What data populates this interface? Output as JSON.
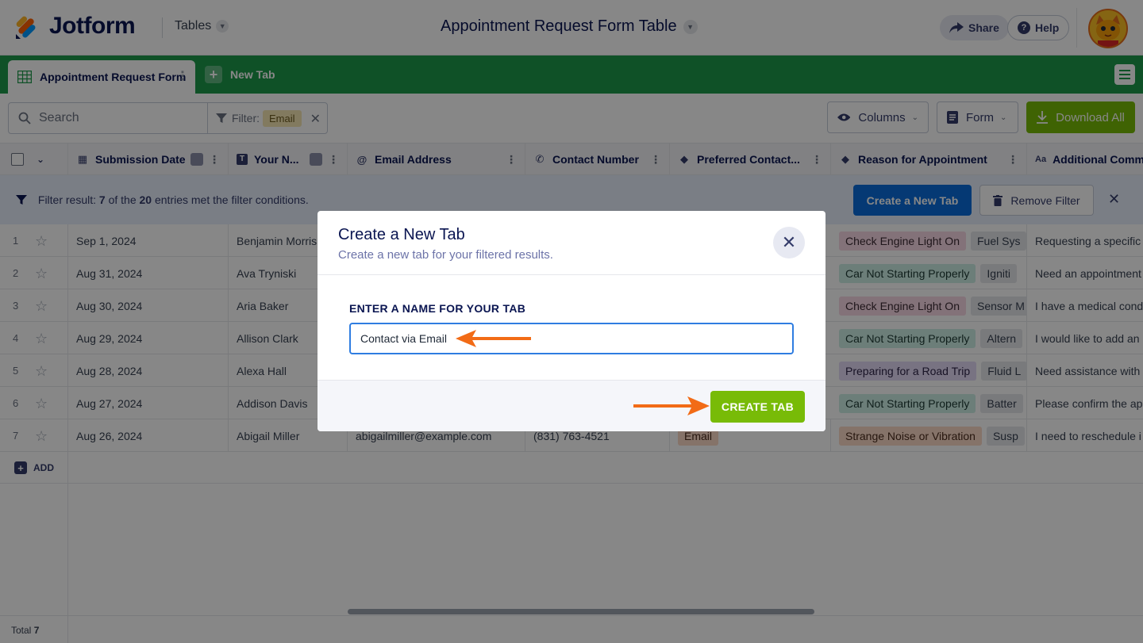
{
  "header": {
    "brand": "Jotform",
    "product": "Tables",
    "page_title": "Appointment Request Form Table",
    "share_label": "Share",
    "help_label": "Help"
  },
  "tabs": {
    "active_label": "Appointment Request Form",
    "new_tab_label": "New Tab"
  },
  "toolbar": {
    "search_placeholder": "Search",
    "filter_label": "Filter:",
    "filter_value": "Email",
    "columns_label": "Columns",
    "form_label": "Form",
    "download_label": "Download All"
  },
  "columns": [
    {
      "label": "Submission Date",
      "icon": "calendar-icon"
    },
    {
      "label": "Your N...",
      "icon": "text-icon"
    },
    {
      "label": "Email Address",
      "icon": "at-icon"
    },
    {
      "label": "Contact Number",
      "icon": "phone-icon"
    },
    {
      "label": "Preferred Contact...",
      "icon": "tag-icon"
    },
    {
      "label": "Reason for Appointment",
      "icon": "tag-icon"
    },
    {
      "label": "Additional Comm",
      "icon": "text-aa-icon"
    }
  ],
  "filter_bar": {
    "prefix": "Filter result: ",
    "count": "7",
    "middle": " of the ",
    "total": "20",
    "suffix": " entries met the filter conditions.",
    "create_tab_label": "Create a New Tab",
    "remove_filter_label": "Remove Filter"
  },
  "rows": [
    {
      "num": "1",
      "date": "Sep 1, 2024",
      "name": "Benjamin Morris",
      "reason": "Check Engine Light On",
      "reason_color": "pink",
      "extra": "Fuel Sys",
      "comment": "Requesting a specific"
    },
    {
      "num": "2",
      "date": "Aug 31, 2024",
      "name": "Ava Tryniski",
      "reason": "Car Not Starting Properly",
      "reason_color": "teal",
      "extra": "Igniti",
      "comment": "Need an appointment"
    },
    {
      "num": "3",
      "date": "Aug 30, 2024",
      "name": "Aria Baker",
      "reason": "Check Engine Light On",
      "reason_color": "pink",
      "extra": "Sensor M",
      "comment": "I have a medical cond"
    },
    {
      "num": "4",
      "date": "Aug 29, 2024",
      "name": "Allison Clark",
      "reason": "Car Not Starting Properly",
      "reason_color": "teal",
      "extra": "Altern",
      "comment": "I would like to add an"
    },
    {
      "num": "5",
      "date": "Aug 28, 2024",
      "name": "Alexa Hall",
      "reason": "Preparing for a Road Trip",
      "reason_color": "purple",
      "extra": "Fluid L",
      "comment": "Need assistance with"
    },
    {
      "num": "6",
      "date": "Aug 27, 2024",
      "name": "Addison Davis",
      "reason": "Car Not Starting Properly",
      "reason_color": "teal",
      "extra": "Batter",
      "comment": "Please confirm the ap"
    },
    {
      "num": "7",
      "date": "Aug 26, 2024",
      "name": "Abigail Miller",
      "email": "abigailmiller@example.com",
      "phone": "(831) 763-4521",
      "contact": "Email",
      "reason": "Strange Noise or Vibration",
      "reason_color": "orange",
      "extra": "Susp",
      "comment": "I need to reschedule i"
    }
  ],
  "add_label": "ADD",
  "footer": {
    "total_label": "Total",
    "total_value": "7"
  },
  "modal": {
    "title": "Create a New Tab",
    "subtitle": "Create a new tab for your filtered results.",
    "field_label": "ENTER A NAME FOR YOUR TAB",
    "field_value": "Contact via Email",
    "create_label": "CREATE TAB"
  },
  "colors": {
    "brand_green": "#1e9a4b",
    "accent_green": "#78bb07",
    "primary_blue": "#0a6ddb",
    "arrow_orange": "#f26b16",
    "navy": "#0a1551"
  }
}
